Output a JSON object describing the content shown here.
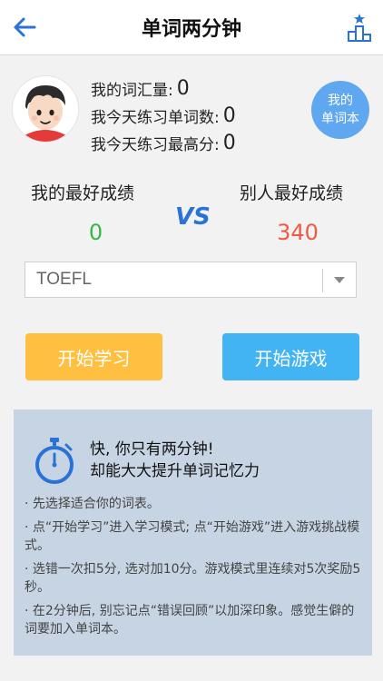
{
  "header": {
    "title": "单词两分钟",
    "back_icon": "arrow-left-icon",
    "rank_icon": "podium-icon"
  },
  "profile": {
    "vocab_label": "我的词汇量:",
    "vocab_value": "0",
    "today_words_label": "我今天练习单词数:",
    "today_words_value": "0",
    "today_best_label": "我今天练习最高分:",
    "today_best_value": "0",
    "wordbook_line1": "我的",
    "wordbook_line2": "单词本"
  },
  "compare": {
    "mine_label": "我的最好成绩",
    "others_label": "别人最好成绩",
    "mine_score": "0",
    "others_score": "340",
    "vs": "VS"
  },
  "wordlist": {
    "selected": "TOEFL"
  },
  "actions": {
    "study_label": "开始学习",
    "game_label": "开始游戏"
  },
  "tips": {
    "headline1": "快, 你只有两分钟!",
    "headline2": "却能大大提升单词记忆力",
    "items": [
      "· 先选择适合你的词表。",
      "· 点“开始学习”进入学习模式; 点“开始游戏”进入游戏挑战模式。",
      "· 选错一次扣5分, 选对加10分。游戏模式里连续对5次奖励5秒。",
      "· 在2分钟后, 别忘记点“错误回顾”以加深印象。感觉生僻的词要加入单词本。"
    ]
  },
  "colors": {
    "accent_blue": "#2a73d6",
    "study_button": "#ffc041",
    "game_button": "#43b4f3",
    "mine_score": "#32b84a",
    "others_score": "#ee5a46"
  }
}
